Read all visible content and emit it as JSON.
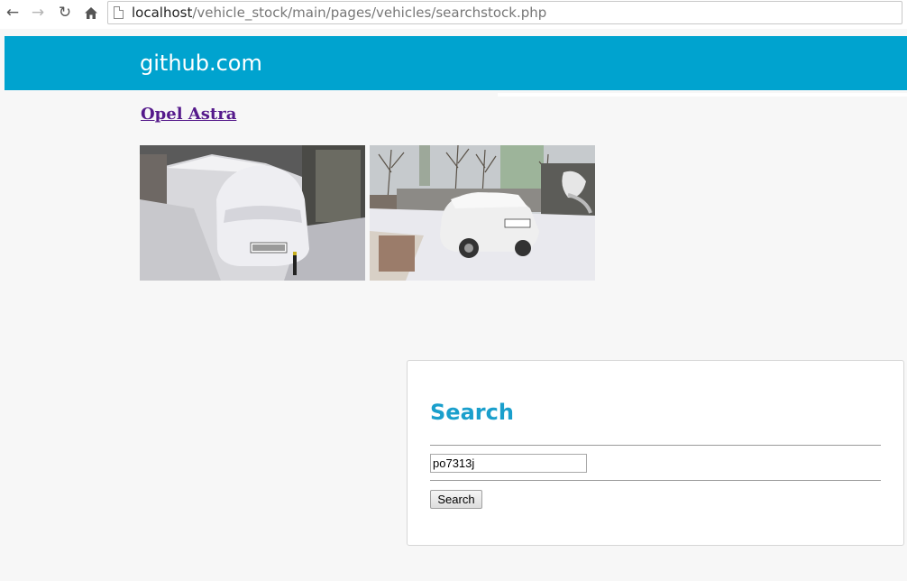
{
  "browser": {
    "url_host": "localhost",
    "url_path": "/vehicle_stock/main/pages/vehicles/searchstock.php"
  },
  "header": {
    "site_title": "github.com",
    "color": "#00a3cf"
  },
  "vehicle": {
    "name": "Opel Astra",
    "photos": [
      {
        "icon": "snow-covered-car-photo"
      },
      {
        "icon": "snowy-car-rear-photo"
      }
    ]
  },
  "search": {
    "title": "Search",
    "input_value": "po7313j",
    "button_label": "Search",
    "accent": "#1a9fcc"
  }
}
